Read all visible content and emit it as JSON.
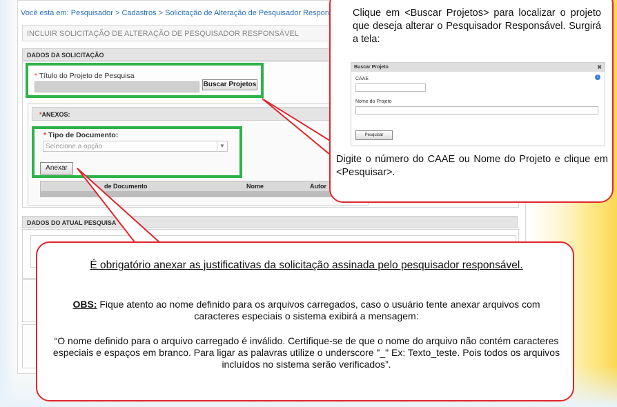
{
  "breadcrumb": "Você está em: Pesquisador > Cadastros > Solicitação de Alteração de Pesquisador Responsável > Incluir",
  "page_title": "INCLUIR SOLICITAÇÃO DE ALTERAÇÃO DE PESQUISADOR RESPONSÁVEL",
  "sections": {
    "dados_solicitacao": "DADOS DA SOLICITAÇÃO",
    "dados_atual": "DADOS DO ATUAL PESQUISA"
  },
  "form": {
    "titulo_label": "Título do Projeto de Pesquisa",
    "buscar_button": "Buscar Projetos",
    "anexos_label": "ANEXOS:",
    "tipo_doc_label": "Tipo de Documento:",
    "select_placeholder": "Selecione a opção",
    "anexar_button": "Anexar",
    "required_mark": "*"
  },
  "table": {
    "headers": [
      "de Documento",
      "Nome",
      "Autor"
    ]
  },
  "callout_top": {
    "text1": "Clique em <Buscar Projetos> para localizar o projeto que deseja alterar o Pesquisador Responsável. Surgirá a tela:",
    "text2": "Digite o número do CAAE ou Nome do Projeto e clique em <Pesquisar>.",
    "mini_dialog": {
      "title": "Buscar Projeto",
      "close": "✖",
      "caae_label": "CAAE",
      "nome_label": "Nome do Projeto",
      "button": "Pesquisar",
      "info": "i"
    }
  },
  "callout_bottom": {
    "title": "É obrigatório anexar as justificativas da solicitação assinada pelo pesquisador responsável.",
    "obs_label": "OBS:",
    "obs_text": " Fique atento ao nome definido para os arquivos carregados, caso o usuário tente anexar arquivos com caracteres especiais o sistema exibirá a mensagem:",
    "message": "“O nome definido para o arquivo carregado é inválido. Certifique-se de que o nome do arquivo não contém caracteres especiais e espaços em branco. Para ligar as palavras utilize o underscore \"_\" Ex: Texto_teste. Pois todos os arquivos incluídos no sistema serão verificados”."
  },
  "colors": {
    "highlight_green": "#2fb24a",
    "callout_red": "#e0262b",
    "link_blue": "#2a6fb4"
  }
}
